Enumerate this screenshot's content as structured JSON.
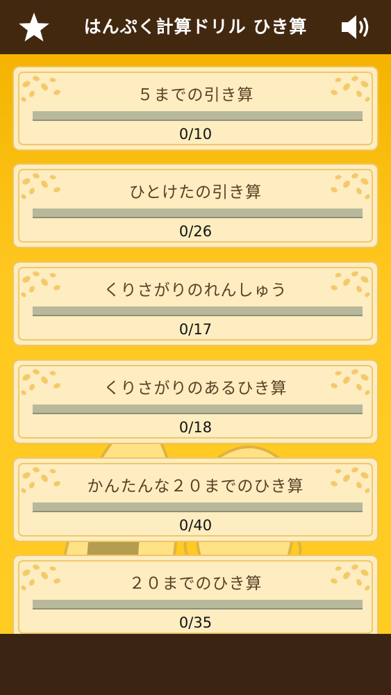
{
  "header": {
    "title": "はんぷく計算ドリル ひき算",
    "favorites_icon": "star-icon",
    "sound_icon": "speaker-icon"
  },
  "colors": {
    "header_bg": "#432810",
    "accent": "#ffc820",
    "card_bg": "#fdedc0",
    "progress_track": "#b8b89c"
  },
  "lessons": [
    {
      "title": "５までの引き算",
      "score": "0/10",
      "progress": 0
    },
    {
      "title": "ひとけたの引き算",
      "score": "0/26",
      "progress": 0
    },
    {
      "title": "くりさがりのれんしゅう",
      "score": "0/17",
      "progress": 0
    },
    {
      "title": "くりさがりのあるひき算",
      "score": "0/18",
      "progress": 0
    },
    {
      "title": "かんたんな２０までのひき算",
      "score": "0/40",
      "progress": 0
    },
    {
      "title": "２０までのひき算",
      "score": "0/35",
      "progress": 0
    }
  ]
}
